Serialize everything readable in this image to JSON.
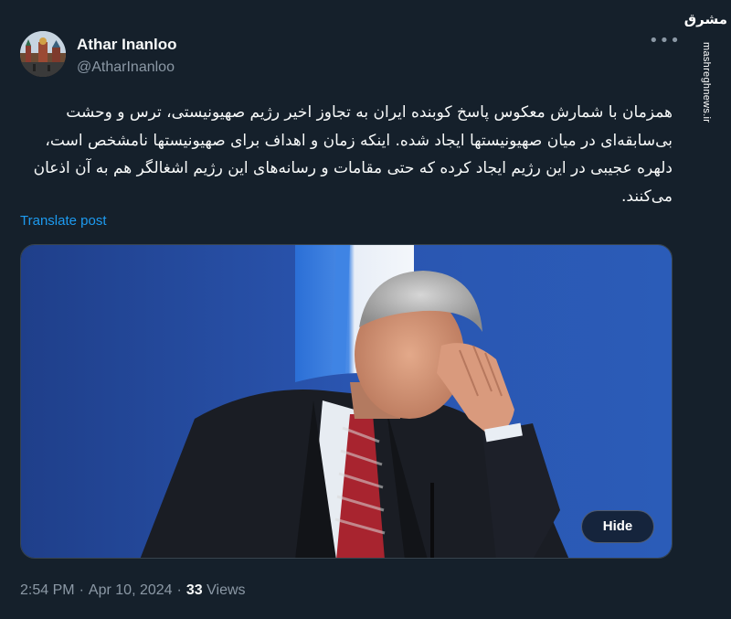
{
  "author": {
    "name": "Athar Inanloo",
    "handle": "@AtharInanloo"
  },
  "watermark": {
    "logo": "مشرق",
    "site": "mashreghnews.ir"
  },
  "post": {
    "text": "همزمان با شمارش معکوس پاسخ کوبنده ایران به تجاوز اخیر رژیم صهیونیستی، ترس و وحشت بی‌سابقه‌ای در میان صهیونیستها ایجاد شده. اینکه زمان و اهداف برای صهیونیستها نامشخص است، دلهره عجیبی در این رژیم ایجاد کرده که حتی مقامات و رسانه‌های این رژیم اشغالگر هم به آن اذعان می‌کنند.",
    "translate_label": "Translate post"
  },
  "media": {
    "hide_label": "Hide"
  },
  "meta": {
    "time": "2:54 PM",
    "date": "Apr 10, 2024",
    "separator": "·",
    "views_count": "33",
    "views_label": "Views"
  },
  "icons": {
    "more": "more-options-icon"
  },
  "colors": {
    "background": "#15202b",
    "text": "#f7f9f9",
    "secondary": "#8b98a5",
    "link": "#1d9bf0"
  }
}
